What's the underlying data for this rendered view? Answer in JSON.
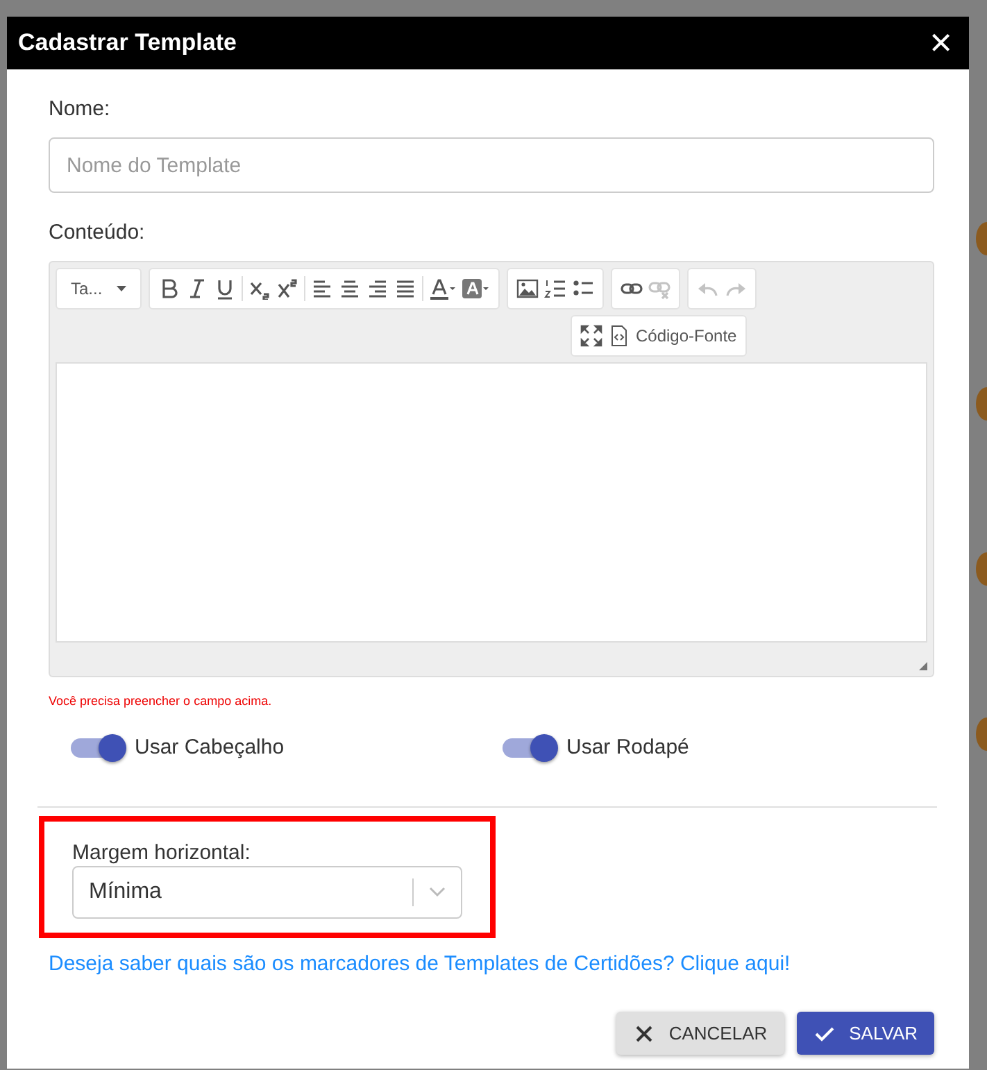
{
  "dialog": {
    "title": "Cadastrar Template",
    "close": "×"
  },
  "name_field": {
    "label": "Nome:",
    "placeholder": "Nome do Template"
  },
  "content_editor": {
    "label": "Conteúdo:",
    "toolbar": [
      [
        {
          "kind": "font",
          "text": "Ta..."
        }
      ],
      [
        {
          "kind": "bold"
        },
        {
          "kind": "italic"
        },
        {
          "kind": "underline"
        },
        {
          "kind": "sep"
        },
        {
          "kind": "subscript"
        },
        {
          "kind": "superscript"
        },
        {
          "kind": "sep"
        },
        {
          "kind": "align-left"
        },
        {
          "kind": "align-center"
        },
        {
          "kind": "align-right"
        },
        {
          "kind": "justify"
        },
        {
          "kind": "sep"
        },
        {
          "kind": "text-color"
        },
        {
          "kind": "highlight"
        }
      ],
      [
        {
          "kind": "image"
        },
        {
          "kind": "ordered-list"
        },
        {
          "kind": "bullet-list"
        }
      ],
      [
        {
          "kind": "link",
          "disabled": false
        },
        {
          "kind": "unlink",
          "disabled": true
        }
      ],
      [
        {
          "kind": "undo",
          "disabled": true
        },
        {
          "kind": "redo",
          "disabled": true
        }
      ],
      [
        {
          "kind": "fullscreen"
        },
        {
          "kind": "source",
          "text": "Código-Fonte"
        }
      ]
    ],
    "error": "Você precisa preencher o campo acima."
  },
  "toggles": [
    {
      "label": "Usar Cabeçalho",
      "on": true
    },
    {
      "label": "Usar Rodapé",
      "on": true
    }
  ],
  "margin_select": {
    "label": "Margem horizontal:",
    "value": "Mínima",
    "highlighted": true
  },
  "help_link": "Deseja saber quais são os marcadores de Templates de Certidões? Clique aqui!",
  "buttons": [
    {
      "kind": "cancel",
      "label": "CANCELAR"
    },
    {
      "kind": "save",
      "label": "SALVAR"
    }
  ]
}
